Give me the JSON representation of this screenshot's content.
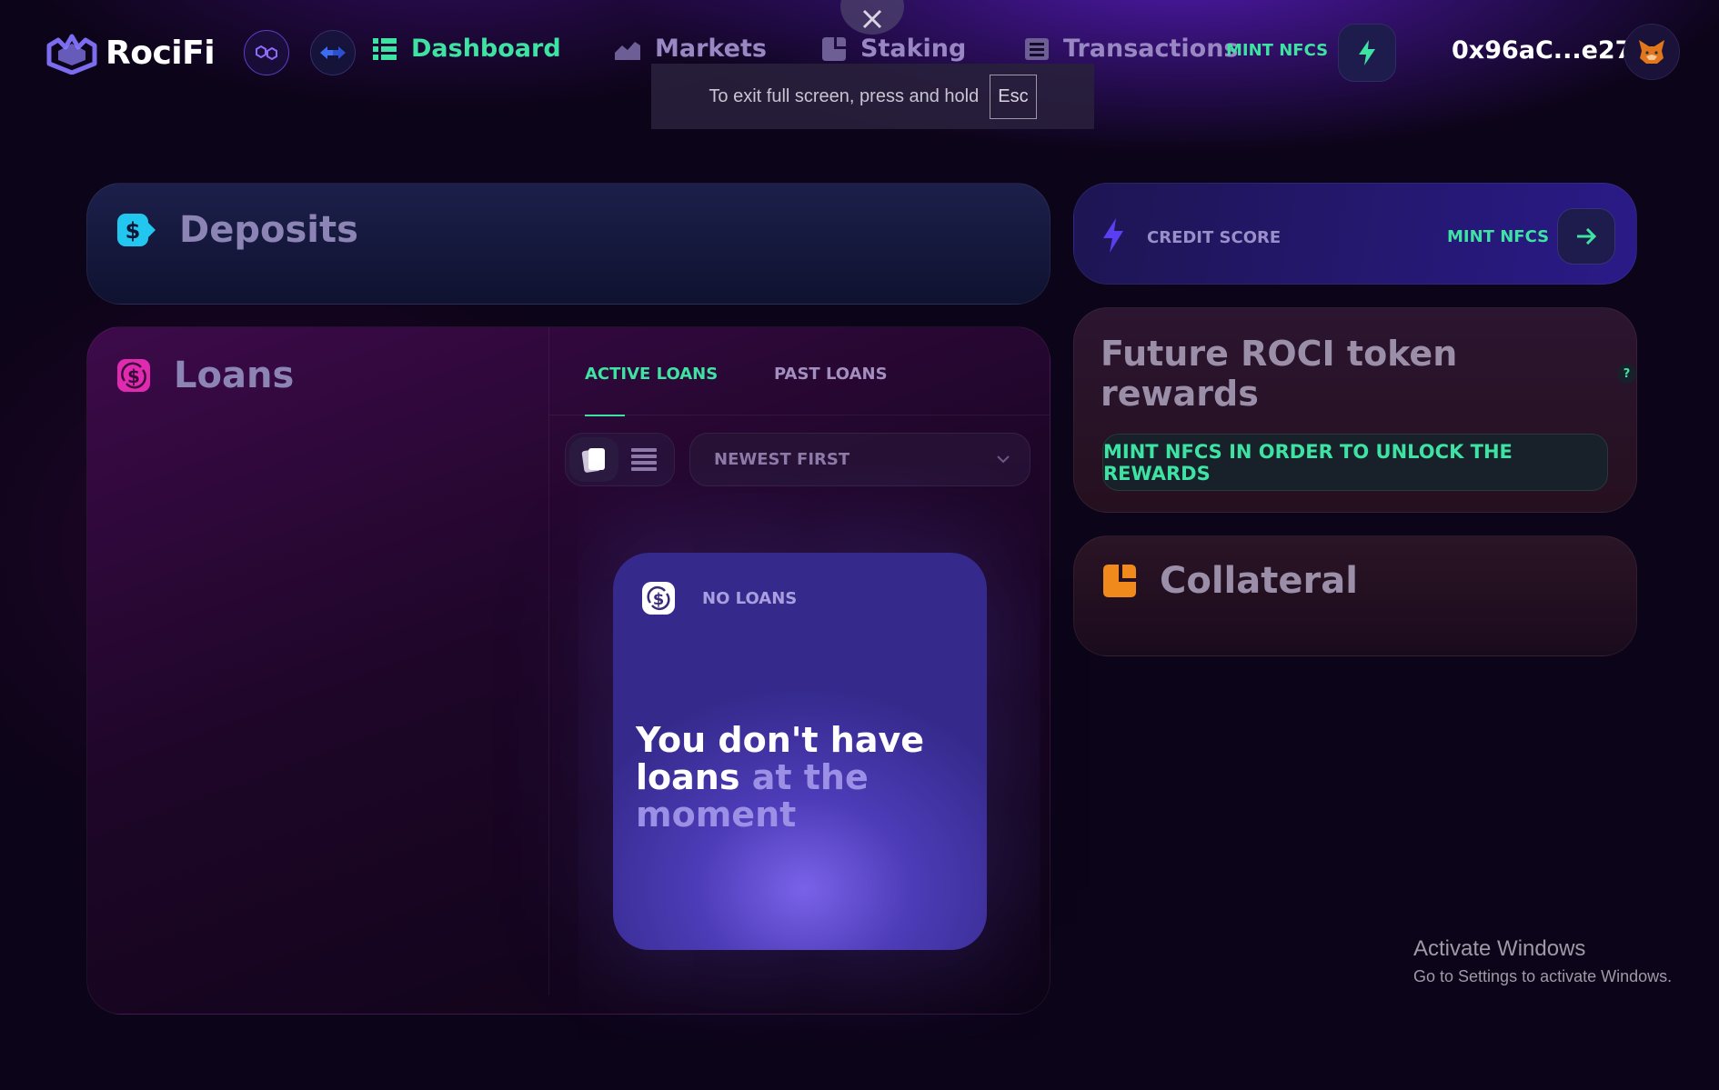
{
  "brand": {
    "name": "RociFi"
  },
  "nav": {
    "items": [
      {
        "label": "Dashboard",
        "icon": "dashboard-icon",
        "active": true
      },
      {
        "label": "Markets",
        "icon": "chart-icon",
        "active": false
      },
      {
        "label": "Staking",
        "icon": "pie-icon",
        "active": false
      },
      {
        "label": "Transactions",
        "icon": "list-icon",
        "active": false
      }
    ],
    "mint_label": "MINT NFCS",
    "wallet_address": "0x96aC...e274"
  },
  "fullscreen_toast": {
    "message": "To exit full screen, press and hold",
    "key": "Esc"
  },
  "deposits": {
    "title": "Deposits"
  },
  "loans": {
    "title": "Loans",
    "tabs": [
      {
        "label": "ACTIVE LOANS",
        "active": true
      },
      {
        "label": "PAST LOANS",
        "active": false
      }
    ],
    "sort": {
      "selected": "NEWEST FIRST"
    },
    "empty": {
      "label": "NO LOANS",
      "message_strong": "You don't have loans",
      "message_dim": "at the moment"
    }
  },
  "credit_score": {
    "label": "CREDIT SCORE",
    "mint_label": "MINT NFCS"
  },
  "rewards": {
    "title": "Future ROCI token rewards",
    "help": "?",
    "button": "MINT NFCS IN ORDER TO UNLOCK THE REWARDS"
  },
  "collateral": {
    "title": "Collateral"
  },
  "windows_activation": {
    "title": "Activate Windows",
    "subtitle": "Go to Settings to activate Windows."
  },
  "colors": {
    "accent_green": "#3ee3a3",
    "purple": "#5b3ec9",
    "deposits_icon": "#22c7f0",
    "loans_icon": "#e02bb0",
    "collateral_icon": "#f08a1c"
  }
}
